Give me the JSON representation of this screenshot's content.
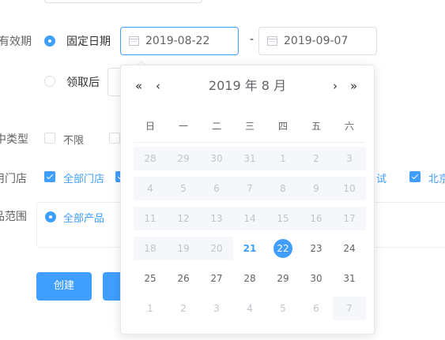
{
  "form": {
    "validity_label": "有效期",
    "validity_label_visible": "有效期",
    "fixed_date_label": "固定日期",
    "after_receive_label": "领取后",
    "start_date": "2019-08-22",
    "end_date": "2019-09-07",
    "range_separator": "-",
    "type_label": "类型",
    "type_label_visible": "中类型",
    "type_option_unlimited": "不限",
    "store_label": "门店",
    "store_label_visible": "用门店",
    "store_all": "全部门店",
    "store_test": "试",
    "store_beijing": "北京",
    "product_label_visible": "品范围",
    "product_all": "全部产品",
    "create_button": "创建"
  },
  "picker": {
    "header": "2019 年  8 月",
    "prev_year": "«",
    "prev_month": "‹",
    "next_month": "›",
    "next_year": "»",
    "weekdays": [
      "日",
      "一",
      "二",
      "三",
      "四",
      "五",
      "六"
    ],
    "weeks": [
      [
        "28",
        "29",
        "30",
        "31",
        "1",
        "2",
        "3"
      ],
      [
        "4",
        "5",
        "6",
        "7",
        "8",
        "9",
        "10"
      ],
      [
        "11",
        "12",
        "13",
        "14",
        "15",
        "16",
        "17"
      ],
      [
        "18",
        "19",
        "20",
        "21",
        "22",
        "23",
        "24"
      ],
      [
        "25",
        "26",
        "27",
        "28",
        "29",
        "30",
        "31"
      ],
      [
        "1",
        "2",
        "3",
        "4",
        "5",
        "6",
        "7"
      ]
    ],
    "today": "21",
    "selected": "22"
  },
  "colors": {
    "primary": "#409eff",
    "disabled_bg": "#f5f7fa",
    "muted_text": "#c0c4cc"
  }
}
